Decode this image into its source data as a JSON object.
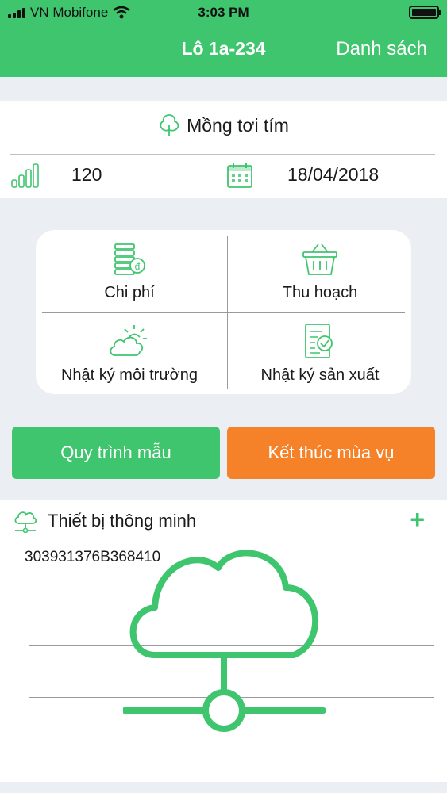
{
  "status_bar": {
    "carrier": "VN Mobifone",
    "time": "3:03 PM",
    "battery_level": 1.0
  },
  "nav": {
    "title": "Lô 1a-234",
    "right_action": "Danh sách"
  },
  "info": {
    "crop_name": "Mồng tơi tím",
    "quantity": "120",
    "date": "18/04/2018"
  },
  "menu": {
    "items": [
      {
        "label": "Chi phí",
        "icon": "coins-icon"
      },
      {
        "label": "Thu hoạch",
        "icon": "basket-icon"
      },
      {
        "label": "Nhật ký môi trường",
        "icon": "weather-icon"
      },
      {
        "label": "Nhật ký sản xuất",
        "icon": "checklist-icon"
      }
    ]
  },
  "actions": {
    "template_process": "Quy trình mẫu",
    "end_season": "Kết thúc mùa vụ"
  },
  "devices": {
    "title": "Thiết bị thông minh",
    "add": "+",
    "items": [
      "303931376B368410"
    ]
  },
  "colors": {
    "primary": "#3fc56e",
    "accent": "#f58228"
  }
}
